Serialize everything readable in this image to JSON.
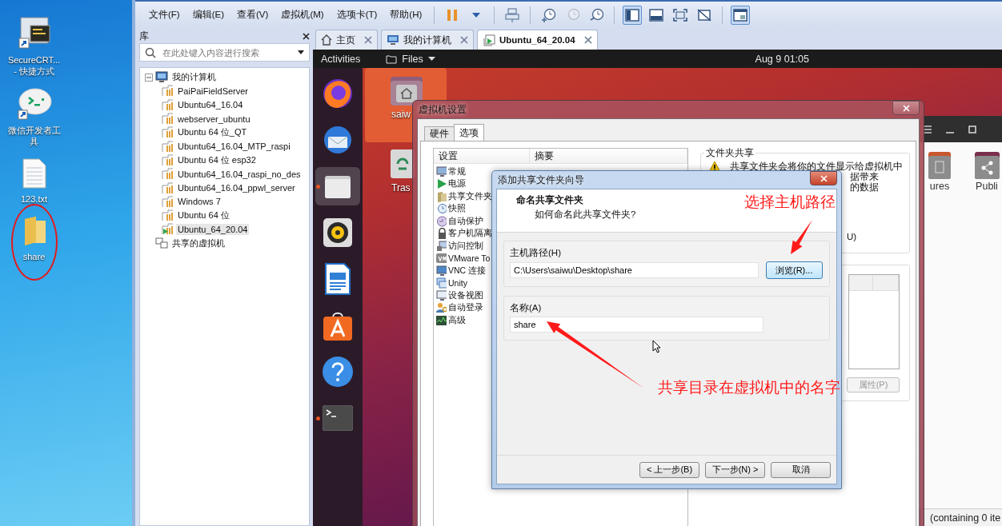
{
  "desktop": {
    "icons": [
      {
        "kind": "terminal",
        "lines": [
          "SecureCRT...",
          "- 快捷方式"
        ],
        "circled": false
      },
      {
        "kind": "chat",
        "lines": [
          "微信开发者工",
          "具"
        ],
        "circled": false
      },
      {
        "kind": "document",
        "lines": [
          "123.txt"
        ],
        "circled": false
      },
      {
        "kind": "folder",
        "lines": [
          "share"
        ],
        "circled": true
      }
    ]
  },
  "menu": [
    "文件(F)",
    "编辑(E)",
    "查看(V)",
    "虚拟机(M)",
    "选项卡(T)",
    "帮助(H)"
  ],
  "toolbar": [
    {
      "kind": "divider"
    },
    {
      "kind": "pause",
      "selected": false,
      "disabled": false
    },
    {
      "kind": "caret",
      "selected": false,
      "disabled": false
    },
    {
      "kind": "divider"
    },
    {
      "kind": "send-keys",
      "selected": false,
      "disabled": false
    },
    {
      "kind": "divider"
    },
    {
      "kind": "snapshot-take",
      "selected": false,
      "disabled": false
    },
    {
      "kind": "snapshot-revert",
      "selected": false,
      "disabled": true
    },
    {
      "kind": "snapshot-manager",
      "selected": false,
      "disabled": false
    },
    {
      "kind": "divider"
    },
    {
      "kind": "sidebar",
      "selected": true,
      "disabled": false
    },
    {
      "kind": "console-view",
      "selected": false,
      "disabled": false
    },
    {
      "kind": "fullscreen",
      "selected": false,
      "disabled": false
    },
    {
      "kind": "unity",
      "selected": false,
      "disabled": false
    },
    {
      "kind": "divider"
    },
    {
      "kind": "thumbnail",
      "selected": true,
      "disabled": false
    }
  ],
  "library": {
    "title": "库",
    "search": {
      "placeholder": "在此处键入内容进行搜索"
    },
    "tree": [
      {
        "label": "我的计算机",
        "kind": "computer",
        "selected": false,
        "expanded": true,
        "children": [
          {
            "label": "PaiPaiFieldServer",
            "kind": "vm",
            "selected": false,
            "running": false
          },
          {
            "label": "Ubuntu64_16.04",
            "kind": "vm",
            "selected": false,
            "running": false
          },
          {
            "label": "webserver_ubuntu",
            "kind": "vm",
            "selected": false,
            "running": false
          },
          {
            "label": "Ubuntu 64 位_QT",
            "kind": "vm",
            "selected": false,
            "running": false
          },
          {
            "label": "Ubuntu64_16.04_MTP_raspi",
            "kind": "vm",
            "selected": false,
            "running": false
          },
          {
            "label": "Ubuntu 64 位 esp32",
            "kind": "vm",
            "selected": false,
            "running": false
          },
          {
            "label": "Ubuntu64_16.04_raspi_no_des",
            "kind": "vm",
            "selected": false,
            "running": false
          },
          {
            "label": "Ubuntu64_16.04_ppwl_server",
            "kind": "vm",
            "selected": false,
            "running": false
          },
          {
            "label": "Windows 7",
            "kind": "vm",
            "selected": false,
            "running": false
          },
          {
            "label": "Ubuntu 64 位",
            "kind": "vm",
            "selected": false,
            "running": false
          },
          {
            "label": "Ubuntu_64_20.04",
            "kind": "vm",
            "selected": true,
            "running": true
          }
        ]
      },
      {
        "label": "共享的虚拟机",
        "kind": "shared",
        "selected": false
      }
    ]
  },
  "tabs": [
    {
      "label": "主页",
      "kind": "home",
      "selected": false
    },
    {
      "label": "我的计算机",
      "kind": "computer",
      "selected": false
    },
    {
      "label": "Ubuntu_64_20.04",
      "kind": "vm",
      "selected": true
    }
  ],
  "guest": {
    "topbar": {
      "activities": "Activities",
      "menu": "Files",
      "clock": "Aug 9  01:05"
    },
    "dock": [
      {
        "kind": "firefox",
        "selected": false,
        "running": false
      },
      {
        "kind": "mail",
        "selected": false,
        "running": false
      },
      {
        "kind": "files",
        "selected": true,
        "running": true
      },
      {
        "kind": "music",
        "selected": false,
        "running": false
      },
      {
        "kind": "writer",
        "selected": false,
        "running": false
      },
      {
        "kind": "store",
        "selected": false,
        "running": false
      },
      {
        "kind": "help",
        "selected": false,
        "running": false
      },
      {
        "kind": "terminal",
        "selected": false,
        "running": true
      }
    ],
    "desktop_icons": [
      {
        "label": "saiw",
        "kind": "home",
        "selected": true
      },
      {
        "label": "Tras",
        "kind": "trash",
        "selected": false
      }
    ],
    "files_window": {
      "items": [
        {
          "label": "ures",
          "kind": "pictures"
        },
        {
          "label": "Publi",
          "kind": "shared"
        }
      ],
      "status": "(containing 0 ite"
    }
  },
  "settings": {
    "title": "虚拟机设置",
    "tabs": [
      {
        "label": "硬件",
        "selected": false
      },
      {
        "label": "选项",
        "selected": true
      }
    ],
    "columns": [
      "设置",
      "摘要"
    ],
    "items": [
      {
        "label": "常规",
        "kind": "general"
      },
      {
        "label": "电源",
        "kind": "power"
      },
      {
        "label": "共享文件夹",
        "kind": "shared-folders"
      },
      {
        "label": "快照",
        "kind": "snapshots"
      },
      {
        "label": "自动保护",
        "kind": "autoprotect"
      },
      {
        "label": "客户机隔离",
        "kind": "isolation"
      },
      {
        "label": "访问控制",
        "kind": "access"
      },
      {
        "label": "VMware To",
        "kind": "tools"
      },
      {
        "label": "VNC 连接",
        "kind": "vnc"
      },
      {
        "label": "Unity",
        "kind": "unity"
      },
      {
        "label": "设备视图",
        "kind": "device"
      },
      {
        "label": "自动登录",
        "kind": "autologin"
      },
      {
        "label": "高级",
        "kind": "advanced"
      }
    ],
    "group": {
      "title": "文件夹共享",
      "warning": "共享文件夹会将你的文件显示给虚拟机中",
      "warning_tail": [
        "据带来",
        "的数据"
      ],
      "option_tail": "U)"
    },
    "properties": "属性(P)"
  },
  "wizard": {
    "title": "添加共享文件夹向导",
    "heading": "命名共享文件夹",
    "subheading": "如何命名此共享文件夹?",
    "host_path": {
      "label": "主机路径(H)",
      "value": "C:\\Users\\saiwu\\Desktop\\share",
      "browse": "浏览(R)..."
    },
    "name": {
      "label": "名称(A)",
      "value": "share"
    },
    "buttons": [
      "< 上一步(B)",
      "下一步(N) >",
      "取消"
    ]
  },
  "annotations": [
    {
      "text": "选择主机路径"
    },
    {
      "text": "共享目录在虚拟机中的名字"
    }
  ]
}
